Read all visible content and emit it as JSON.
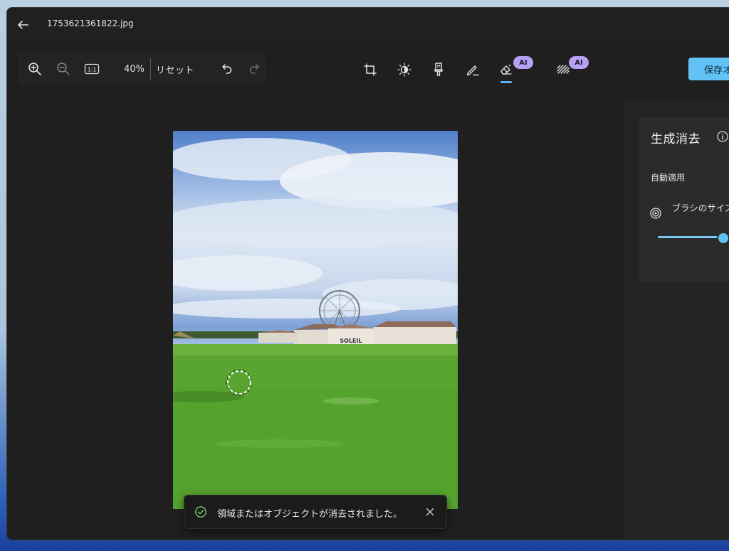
{
  "titlebar": {
    "file_name": "1753621361822.jpg",
    "back_icon": "back-arrow-icon"
  },
  "zoom_bar": {
    "zoom_in_icon": "zoom-in-icon",
    "zoom_out_icon": "zoom-out-icon",
    "actual_size_label": "1:1",
    "zoom_percent": "40%",
    "reset_label": "リセット",
    "undo_icon": "undo-icon",
    "redo_icon": "redo-icon"
  },
  "tools": [
    {
      "name": "crop",
      "icon": "crop-icon"
    },
    {
      "name": "adjust",
      "icon": "brightness-icon"
    },
    {
      "name": "filter",
      "icon": "filter-icon"
    },
    {
      "name": "markup",
      "icon": "markup-pen-icon"
    },
    {
      "name": "erase",
      "icon": "generative-erase-icon",
      "badge": "AI",
      "active": true
    },
    {
      "name": "background",
      "icon": "background-blur-icon",
      "badge": "AI"
    }
  ],
  "save_button": {
    "label": "保存オ"
  },
  "side_panel": {
    "title": "生成消去",
    "auto_apply_label": "自動適用",
    "brush_size_label": "ブラシのサイズ",
    "brush_size_level": 0.9
  },
  "photo": {
    "sign_text": "SOLEIL"
  },
  "toast": {
    "message": "領域またはオブジェクトが消去されました。"
  },
  "colors": {
    "accent": "#62c2f6",
    "ai_badge": "#b7a1f2",
    "success": "#6ccb5f"
  }
}
